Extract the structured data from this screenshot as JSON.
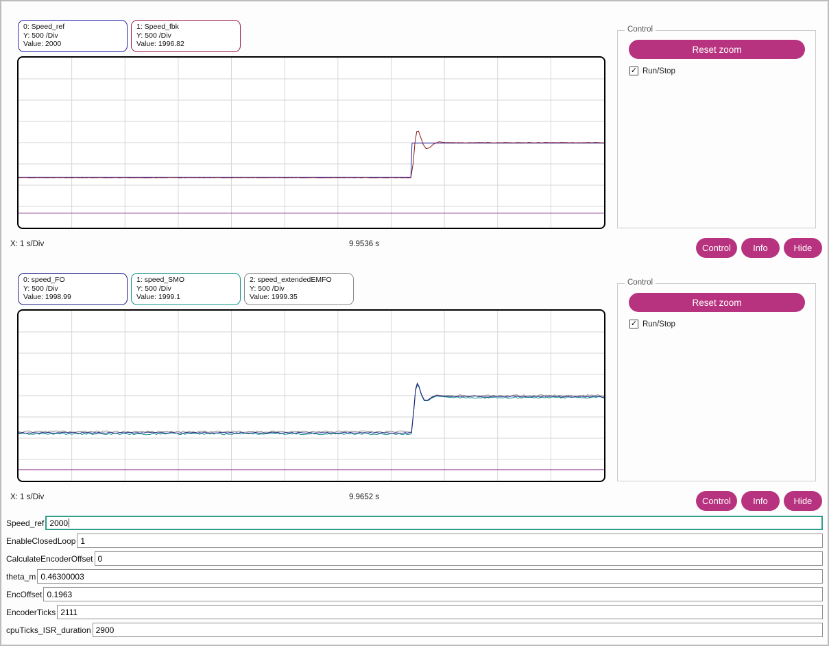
{
  "colors": {
    "accent": "#b8337f",
    "focus_border": "#2f9e8a",
    "grid": "#d6d6d6",
    "chart_border": "#000000",
    "marker": "#8f3a8f"
  },
  "scopes": [
    {
      "legends": [
        {
          "title": "0: Speed_ref",
          "y_div": "Y: 500 /Div",
          "value": "Value: 2000",
          "color": "#2a2aad"
        },
        {
          "title": "1: Speed_fbk",
          "y_div": "Y: 500 /Div",
          "value": "Value: 1996.82",
          "color": "#a02248"
        }
      ],
      "x_div_label": "X: 1 s/Div",
      "time_label": "9.9536 s",
      "control_group": {
        "title": "Control",
        "reset_button": "Reset zoom",
        "run_stop_label": "Run/Stop",
        "run_stop_checked": true,
        "check_glyph": "✓"
      },
      "footer_buttons": [
        "Control",
        "Info",
        "Hide"
      ],
      "chart_data": {
        "type": "line",
        "x_divisions": 11,
        "y_divisions": 8,
        "x_scale": "1 s/Div",
        "y_scale": "500 /Div",
        "time_cursor_s": 9.9536,
        "series": [
          {
            "name": "Speed_ref",
            "color": "#2a2aad",
            "noise": 0,
            "points_norm": [
              [
                0,
                0.703
              ],
              [
                0.67,
                0.703
              ],
              [
                0.672,
                0.503
              ],
              [
                1,
                0.503
              ]
            ]
          },
          {
            "name": "Speed_fbk",
            "color": "#8b1a1a",
            "noise": 0.4,
            "points_norm": [
              [
                0,
                0.706
              ],
              [
                0.67,
                0.706
              ],
              [
                0.674,
                0.62
              ],
              [
                0.677,
                0.5
              ],
              [
                0.68,
                0.435
              ],
              [
                0.683,
                0.432
              ],
              [
                0.687,
                0.47
              ],
              [
                0.691,
                0.51
              ],
              [
                0.696,
                0.535
              ],
              [
                0.702,
                0.53
              ],
              [
                0.709,
                0.508
              ],
              [
                0.718,
                0.495
              ],
              [
                0.73,
                0.5
              ],
              [
                1,
                0.5
              ]
            ]
          },
          {
            "name": "marker",
            "color": "#8f3a8f",
            "noise": 0,
            "points_norm": [
              [
                0,
                0.915
              ],
              [
                1,
                0.915
              ]
            ]
          }
        ]
      }
    },
    {
      "legends": [
        {
          "title": "0: speed_FO",
          "y_div": "Y: 500 /Div",
          "value": "Value: 1998.99",
          "color": "#20208b"
        },
        {
          "title": "1: speed_SMO",
          "y_div": "Y: 500 /Div",
          "value": "Value: 1999.1",
          "color": "#12948c"
        },
        {
          "title": "2: speed_extendedEMFO",
          "y_div": "Y: 500 /Div",
          "value": "Value: 1999.35",
          "color": "#8a8a8a"
        }
      ],
      "x_div_label": "X: 1 s/Div",
      "time_label": "9.9652 s",
      "control_group": {
        "title": "Control",
        "reset_button": "Reset zoom",
        "run_stop_label": "Run/Stop",
        "run_stop_checked": true,
        "check_glyph": "✓"
      },
      "footer_buttons": [
        "Control",
        "Info",
        "Hide"
      ],
      "chart_data": {
        "type": "line",
        "x_divisions": 11,
        "y_divisions": 8,
        "x_scale": "1 s/Div",
        "y_scale": "500 /Div",
        "time_cursor_s": 9.9652,
        "series": [
          {
            "name": "speed_extendedEMFO",
            "color": "#8a8a8a",
            "noise": 1.2,
            "points_norm": [
              [
                0,
                0.712
              ],
              [
                0.671,
                0.712
              ],
              [
                0.675,
                0.58
              ],
              [
                0.678,
                0.46
              ],
              [
                0.681,
                0.424
              ],
              [
                0.684,
                0.445
              ],
              [
                0.688,
                0.49
              ],
              [
                0.693,
                0.525
              ],
              [
                0.699,
                0.525
              ],
              [
                0.706,
                0.507
              ],
              [
                0.714,
                0.496
              ],
              [
                0.726,
                0.5
              ],
              [
                0.74,
                0.499
              ],
              [
                1,
                0.499
              ]
            ]
          },
          {
            "name": "speed_SMO",
            "color": "#12948c",
            "noise": 1.2,
            "points_norm": [
              [
                0,
                0.724
              ],
              [
                0.671,
                0.724
              ],
              [
                0.675,
                0.59
              ],
              [
                0.678,
                0.47
              ],
              [
                0.681,
                0.436
              ],
              [
                0.684,
                0.45
              ],
              [
                0.688,
                0.496
              ],
              [
                0.693,
                0.53
              ],
              [
                0.699,
                0.53
              ],
              [
                0.706,
                0.513
              ],
              [
                0.714,
                0.502
              ],
              [
                0.726,
                0.506
              ],
              [
                0.74,
                0.511
              ],
              [
                1,
                0.511
              ]
            ]
          },
          {
            "name": "speed_FO",
            "color": "#20208b",
            "noise": 1.0,
            "points_norm": [
              [
                0,
                0.718
              ],
              [
                0.671,
                0.718
              ],
              [
                0.675,
                0.585
              ],
              [
                0.678,
                0.465
              ],
              [
                0.681,
                0.43
              ],
              [
                0.684,
                0.448
              ],
              [
                0.688,
                0.493
              ],
              [
                0.693,
                0.527
              ],
              [
                0.699,
                0.527
              ],
              [
                0.706,
                0.51
              ],
              [
                0.714,
                0.499
              ],
              [
                0.726,
                0.503
              ],
              [
                0.74,
                0.505
              ],
              [
                1,
                0.505
              ]
            ]
          },
          {
            "name": "marker",
            "color": "#8f3a8f",
            "noise": 0,
            "points_norm": [
              [
                0,
                0.935
              ],
              [
                1,
                0.935
              ]
            ]
          }
        ]
      }
    }
  ],
  "watch_fields": [
    {
      "label": "Speed_ref",
      "value": "2000",
      "focused": true
    },
    {
      "label": "EnableClosedLoop",
      "value": "1",
      "focused": false
    },
    {
      "label": "CalculateEncoderOffset",
      "value": "0",
      "focused": false
    },
    {
      "label": "theta_m",
      "value": "0.46300003",
      "focused": false
    },
    {
      "label": "EncOffset",
      "value": "0.1963",
      "focused": false
    },
    {
      "label": "EncoderTicks",
      "value": "2111",
      "focused": false
    },
    {
      "label": "cpuTicks_ISR_duration",
      "value": "2900",
      "focused": false
    }
  ]
}
